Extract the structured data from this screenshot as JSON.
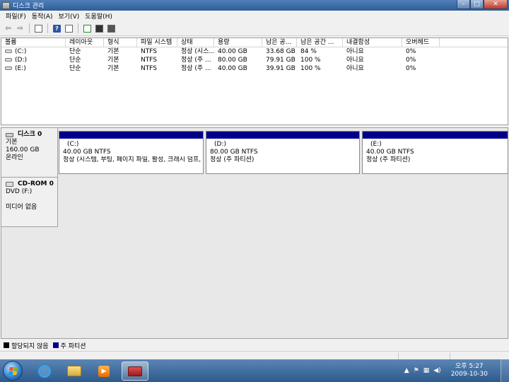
{
  "window": {
    "title": "디스크 관리",
    "min_glyph": "–",
    "max_glyph": "□",
    "close_glyph": "✕"
  },
  "menu": [
    "파일(F)",
    "동작(A)",
    "보기(V)",
    "도움말(H)"
  ],
  "toolbar": {
    "back_glyph": "⇦",
    "forward_glyph": "⇨",
    "help_glyph": "?"
  },
  "volumes": {
    "columns": [
      "볼륨",
      "레이아웃",
      "형식",
      "파일 시스템",
      "상태",
      "용량",
      "남은 공...",
      "남은 공간 ...",
      "내결함성",
      "오버헤드"
    ],
    "rows": [
      [
        "(C:)",
        "단순",
        "기본",
        "NTFS",
        "정상 (시스...",
        "40.00 GB",
        "33.68 GB",
        "84 %",
        "아니요",
        "0%"
      ],
      [
        "(D:)",
        "단순",
        "기본",
        "NTFS",
        "정상 (주 ...",
        "80.00 GB",
        "79.91 GB",
        "100 %",
        "아니요",
        "0%"
      ],
      [
        "(E:)",
        "단순",
        "기본",
        "NTFS",
        "정상 (주 ...",
        "40.00 GB",
        "39.91 GB",
        "100 %",
        "아니요",
        "0%"
      ]
    ]
  },
  "disk0": {
    "name": "디스크 0",
    "type": "기본",
    "size": "160.00 GB",
    "state": "온라인",
    "partitions": [
      {
        "name": "(C:)",
        "size": "40.00 GB NTFS",
        "status": "정상 (시스템, 부팅, 페이지 파일, 활성, 크래시 덤프,"
      },
      {
        "name": "(D:)",
        "size": "80.00 GB NTFS",
        "status": "정상 (주 파티션)"
      },
      {
        "name": "(E:)",
        "size": "40.00 GB NTFS",
        "status": "정상 (주 파티션)"
      }
    ]
  },
  "cdrom": {
    "name": "CD-ROM 0",
    "type": "DVD (F:)",
    "media": "미디어 없음"
  },
  "legend": [
    {
      "label": "할당되지 않음",
      "color": "#000000"
    },
    {
      "label": "주 파티션",
      "color": "#00008b"
    }
  ],
  "taskbar": {
    "media_glyph": "▶",
    "tray_up_glyph": "▲",
    "tray_flag_glyph": "⚑",
    "tray_net_glyph": "▦",
    "tray_volume_glyph": "◀)",
    "clock_time": "오후 5:27",
    "clock_date": "2009-10-30"
  },
  "colors": {
    "primary_partition": "#00008b",
    "title_bar": "#3a6aa6",
    "taskbar": "#3a679a"
  }
}
